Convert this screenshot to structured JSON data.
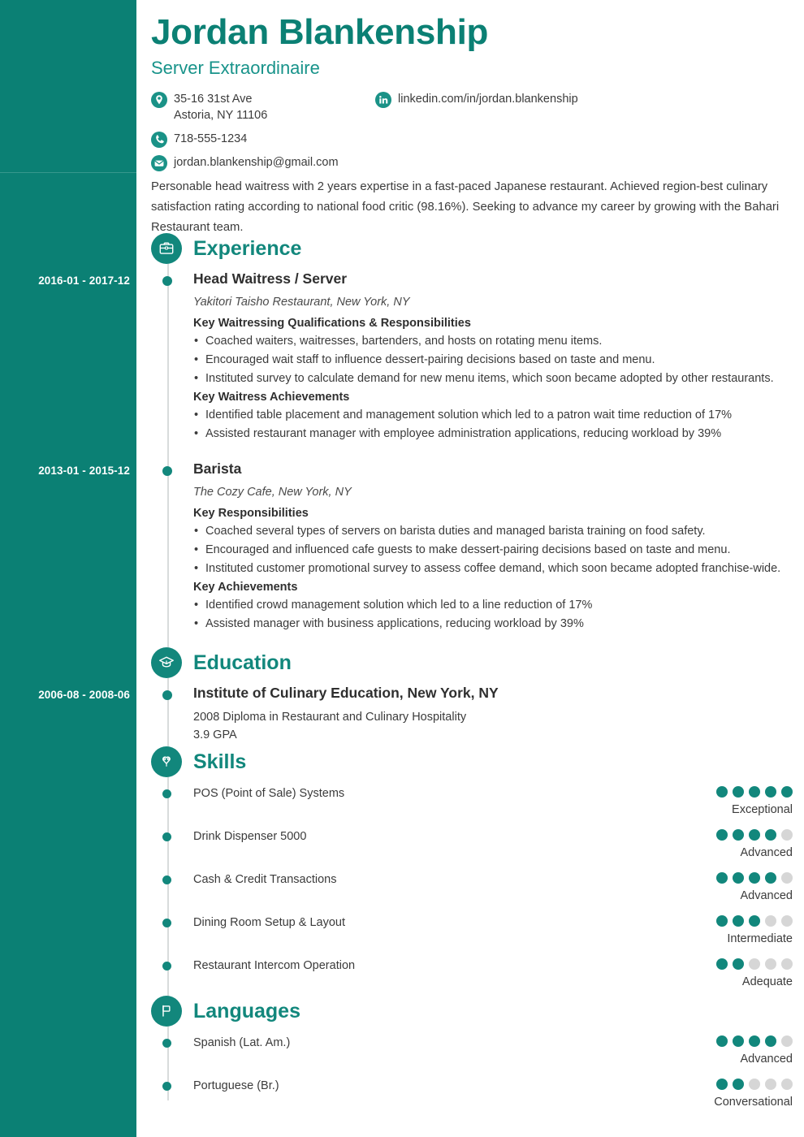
{
  "header": {
    "name": "Jordan Blankenship",
    "job_title": "Server Extraordinaire",
    "contacts": {
      "address_line1": "35-16 31st Ave",
      "address_line2": "Astoria, NY 11106",
      "phone": "718-555-1234",
      "email": "jordan.blankenship@gmail.com",
      "linkedin": "linkedin.com/in/jordan.blankenship"
    },
    "icons": {
      "address": "location-pin-icon",
      "phone": "phone-icon",
      "email": "envelope-icon",
      "linkedin": "linkedin-icon"
    }
  },
  "summary": "Personable head waitress with 2 years expertise in a fast-paced Japanese restaurant. Achieved region-best culinary satisfaction rating according to national food critic (98.16%). Seeking to advance my career by growing with the Bahari Restaurant team.",
  "sections": {
    "experience": {
      "title": "Experience",
      "icon": "briefcase-icon",
      "entries": [
        {
          "dates": "2016-01 - 2017-12",
          "title": "Head Waitress / Server",
          "subtitle": "Yakitori Taisho Restaurant, New York, NY",
          "groups": [
            {
              "label": "Key Waitressing Qualifications & Responsibilities",
              "bullets": [
                "Coached waiters, waitresses, bartenders, and hosts on rotating menu items.",
                "Encouraged wait staff to influence dessert-pairing decisions based on taste and menu.",
                "Instituted survey to calculate demand for new menu items, which soon became adopted by other restaurants."
              ]
            },
            {
              "label": "Key Waitress Achievements",
              "bullets": [
                "Identified table placement and management solution which led to a patron wait time reduction of 17%",
                "Assisted restaurant manager with employee administration applications, reducing workload by 39%"
              ]
            }
          ]
        },
        {
          "dates": "2013-01 - 2015-12",
          "title": "Barista",
          "subtitle": "The Cozy Cafe, New York, NY",
          "groups": [
            {
              "label": "Key Responsibilities",
              "bullets": [
                "Coached several types of servers on barista duties and managed barista training on food safety.",
                "Encouraged and influenced cafe guests to make dessert-pairing decisions based on taste and menu.",
                "Instituted customer promotional survey to assess coffee demand, which soon became adopted franchise-wide."
              ]
            },
            {
              "label": "Key Achievements",
              "bullets": [
                "Identified crowd management solution which led to a line reduction of 17%",
                "Assisted manager with business applications, reducing workload by 39%"
              ]
            }
          ]
        }
      ]
    },
    "education": {
      "title": "Education",
      "icon": "graduation-cap-icon",
      "entries": [
        {
          "dates": "2006-08 - 2008-06",
          "title": "Institute of Culinary Education, New York, NY",
          "line1": "2008 Diploma in Restaurant and Culinary Hospitality",
          "line2": "3.9 GPA"
        }
      ]
    },
    "skills": {
      "title": "Skills",
      "icon": "puzzle-heart-icon",
      "max_rating": 5,
      "items": [
        {
          "label": "POS (Point of Sale) Systems",
          "rating": 5,
          "level": "Exceptional"
        },
        {
          "label": "Drink Dispenser 5000",
          "rating": 4,
          "level": "Advanced"
        },
        {
          "label": "Cash & Credit Transactions",
          "rating": 4,
          "level": "Advanced"
        },
        {
          "label": "Dining Room Setup & Layout",
          "rating": 3,
          "level": "Intermediate"
        },
        {
          "label": "Restaurant Intercom Operation",
          "rating": 2,
          "level": "Adequate"
        }
      ]
    },
    "languages": {
      "title": "Languages",
      "icon": "flag-icon",
      "max_rating": 5,
      "items": [
        {
          "label": "Spanish (Lat. Am.)",
          "rating": 4,
          "level": "Advanced"
        },
        {
          "label": "Portuguese (Br.)",
          "rating": 2,
          "level": "Conversational"
        }
      ]
    }
  },
  "colors": {
    "sidebar": "#0b8074",
    "accent": "#12877c",
    "text": "#3b3b3b",
    "dot_off": "#d6d6d6"
  }
}
